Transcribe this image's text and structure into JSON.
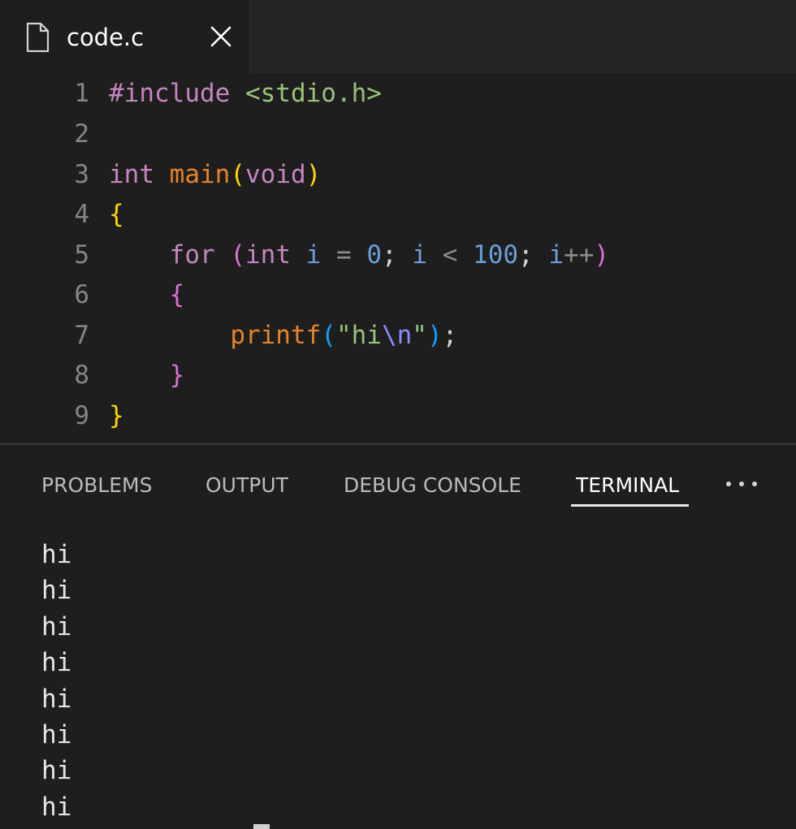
{
  "tab": {
    "filename": "code.c",
    "file_icon": "file-icon",
    "close_icon": "close-icon"
  },
  "editor": {
    "lines": [
      {
        "num": "1",
        "tokens": [
          {
            "t": "#include",
            "c": "inc"
          },
          {
            "t": " ",
            "c": "punc"
          },
          {
            "t": "<stdio.h>",
            "c": "hdr"
          }
        ]
      },
      {
        "num": "2",
        "tokens": []
      },
      {
        "num": "3",
        "tokens": [
          {
            "t": "int",
            "c": "type"
          },
          {
            "t": " ",
            "c": "punc"
          },
          {
            "t": "main",
            "c": "fn"
          },
          {
            "t": "(",
            "c": "br1"
          },
          {
            "t": "void",
            "c": "type"
          },
          {
            "t": ")",
            "c": "br1"
          }
        ]
      },
      {
        "num": "4",
        "tokens": [
          {
            "t": "{",
            "c": "br1"
          }
        ]
      },
      {
        "num": "5",
        "tokens": [
          {
            "t": "    ",
            "c": "punc"
          },
          {
            "t": "for",
            "c": "kw"
          },
          {
            "t": " ",
            "c": "punc"
          },
          {
            "t": "(",
            "c": "br2"
          },
          {
            "t": "int",
            "c": "type"
          },
          {
            "t": " ",
            "c": "punc"
          },
          {
            "t": "i",
            "c": "var"
          },
          {
            "t": " ",
            "c": "punc"
          },
          {
            "t": "=",
            "c": "op"
          },
          {
            "t": " ",
            "c": "punc"
          },
          {
            "t": "0",
            "c": "num"
          },
          {
            "t": "; ",
            "c": "punc"
          },
          {
            "t": "i",
            "c": "var"
          },
          {
            "t": " ",
            "c": "punc"
          },
          {
            "t": "<",
            "c": "op"
          },
          {
            "t": " ",
            "c": "punc"
          },
          {
            "t": "100",
            "c": "num"
          },
          {
            "t": "; ",
            "c": "punc"
          },
          {
            "t": "i",
            "c": "var"
          },
          {
            "t": "++",
            "c": "op"
          },
          {
            "t": ")",
            "c": "br2"
          }
        ]
      },
      {
        "num": "6",
        "tokens": [
          {
            "t": "    ",
            "c": "punc"
          },
          {
            "t": "{",
            "c": "br2"
          }
        ]
      },
      {
        "num": "7",
        "tokens": [
          {
            "t": "        ",
            "c": "punc"
          },
          {
            "t": "printf",
            "c": "fn"
          },
          {
            "t": "(",
            "c": "br3"
          },
          {
            "t": "\"hi",
            "c": "str"
          },
          {
            "t": "\\n",
            "c": "esc"
          },
          {
            "t": "\"",
            "c": "str"
          },
          {
            "t": ")",
            "c": "br3"
          },
          {
            "t": ";",
            "c": "punc"
          }
        ]
      },
      {
        "num": "8",
        "tokens": [
          {
            "t": "    ",
            "c": "punc"
          },
          {
            "t": "}",
            "c": "br2"
          }
        ]
      },
      {
        "num": "9",
        "tokens": [
          {
            "t": "}",
            "c": "br1"
          }
        ]
      }
    ]
  },
  "panel": {
    "tabs": [
      {
        "label": "PROBLEMS",
        "active": false
      },
      {
        "label": "OUTPUT",
        "active": false
      },
      {
        "label": "DEBUG CONSOLE",
        "active": false
      },
      {
        "label": "TERMINAL",
        "active": true
      }
    ],
    "more_icon": "more-icon"
  },
  "terminal": {
    "lines": [
      "hi",
      "hi",
      "hi",
      "hi",
      "hi",
      "hi",
      "hi",
      "hi"
    ]
  }
}
